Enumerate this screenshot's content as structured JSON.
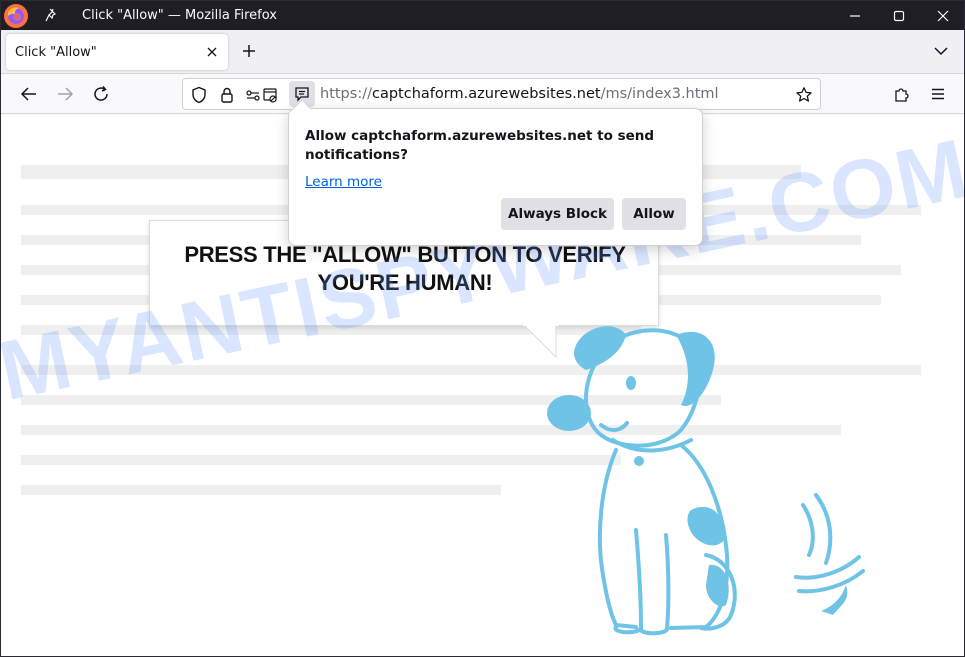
{
  "window": {
    "title": "Click \"Allow\" — Mozilla Firefox"
  },
  "tabs": [
    {
      "label": "Click \"Allow\""
    }
  ],
  "urlbar": {
    "scheme": "https://",
    "host": "captchaform.azurewebsites.net",
    "path": "/ms/index3.html"
  },
  "notification": {
    "message": "Allow captchaform.azurewebsites.net to send notifications?",
    "learn_more": "Learn more",
    "block_label": "Always Block",
    "allow_label": "Allow"
  },
  "page": {
    "headline_line1": "PRESS THE \"ALLOW\" BUTTON TO VERIFY",
    "headline_line2": "YOU'RE HUMAN!",
    "watermark": "MYANTISPYWARE.COM"
  },
  "colors": {
    "dog": "#6ec3e6",
    "accent_link": "#0061e0",
    "titlebar": "#1f1e25"
  },
  "icons": [
    "firefox-logo-icon",
    "pin-icon",
    "minimize-icon",
    "maximize-icon",
    "close-icon",
    "tab-close-icon",
    "new-tab-icon",
    "list-all-tabs-icon",
    "back-icon",
    "forward-icon",
    "reload-icon",
    "shield-icon",
    "lock-icon",
    "permissions-icon",
    "notification-permission-icon",
    "bookmark-star-icon",
    "extensions-icon",
    "menu-icon"
  ]
}
